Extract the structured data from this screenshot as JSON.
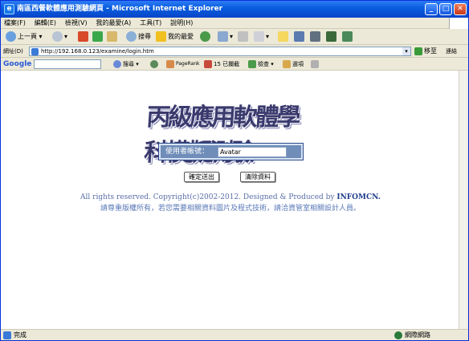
{
  "window": {
    "title": "南區西餐軟體應用測驗網頁 - Microsoft Internet Explorer"
  },
  "menu": [
    "檔案(F)",
    "編輯(E)",
    "檢視(V)",
    "我的最愛(A)",
    "工具(T)",
    "說明(H)"
  ],
  "toolbar": {
    "back": "上一頁",
    "search": "搜尋",
    "favorites": "我的最愛"
  },
  "address": {
    "label": "網址(D)",
    "url": "http://192.168.0.123/examine/login.htm",
    "go": "移至",
    "links": "連結"
  },
  "googlebar": {
    "brand": "Google",
    "search": "搜尋",
    "pagerank": "PageRank",
    "blocked": "15 已攔截",
    "check": "檢查",
    "options": "選項"
  },
  "page": {
    "banner": "丙級應用軟體學科模擬測驗",
    "login_label": "使用者帳號：",
    "login_value": "Avatar",
    "submit": "確定送出",
    "clear": "清除資料",
    "copyright_prefix": "All rights reserved. Copyright(c)2002-2012. Designed & Produced by ",
    "copyright_brand": "INFOMCN.",
    "notice": "請尊重版權所有，若您需要相關資料圖片及程式技術，請洽資管室相關設計人員。"
  },
  "status": {
    "text": "完成",
    "zone": "網際網路"
  },
  "colors": {
    "title_blue": "#0a5fe0",
    "login_bg": "#6f8db8",
    "link_blue": "#5a6ea8"
  }
}
